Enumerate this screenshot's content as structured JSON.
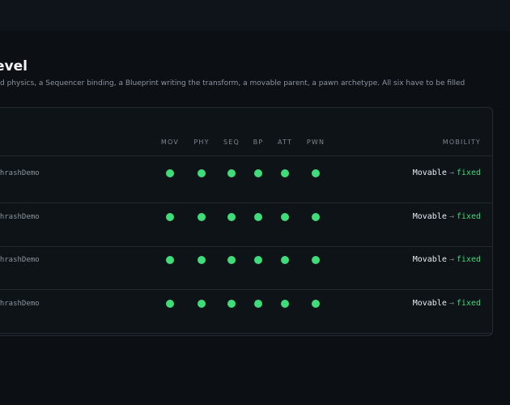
{
  "page": {
    "title": "evel",
    "subtitle": "d physics, a Sequencer binding, a Blueprint writing the transform, a movable parent, a pawn archetype. All six have to be filled"
  },
  "table": {
    "columns": [
      "MOV",
      "PHY",
      "SEQ",
      "BP",
      "ATT",
      "PWN"
    ],
    "mobility_header": "MOBILITY",
    "rows": [
      {
        "name": "/ThrashDemo",
        "flags": [
          true,
          true,
          true,
          true,
          true,
          true
        ],
        "mobility_from": "Movable",
        "arrow": "→",
        "mobility_to": "fixed"
      },
      {
        "name": "/ThrashDemo",
        "flags": [
          true,
          true,
          true,
          true,
          true,
          true
        ],
        "mobility_from": "Movable",
        "arrow": "→",
        "mobility_to": "fixed"
      },
      {
        "name": "/ThrashDemo",
        "flags": [
          true,
          true,
          true,
          true,
          true,
          true
        ],
        "mobility_from": "Movable",
        "arrow": "→",
        "mobility_to": "fixed"
      },
      {
        "name": "/ThrashDemo",
        "flags": [
          true,
          true,
          true,
          true,
          true,
          true
        ],
        "mobility_from": "Movable",
        "arrow": "→",
        "mobility_to": "fixed"
      }
    ]
  },
  "colors": {
    "background": "#0c1015",
    "panel": "#0e1318",
    "accent_green": "#3fdc7a",
    "text_muted": "#8b949e",
    "title": "#f2f4f7"
  }
}
